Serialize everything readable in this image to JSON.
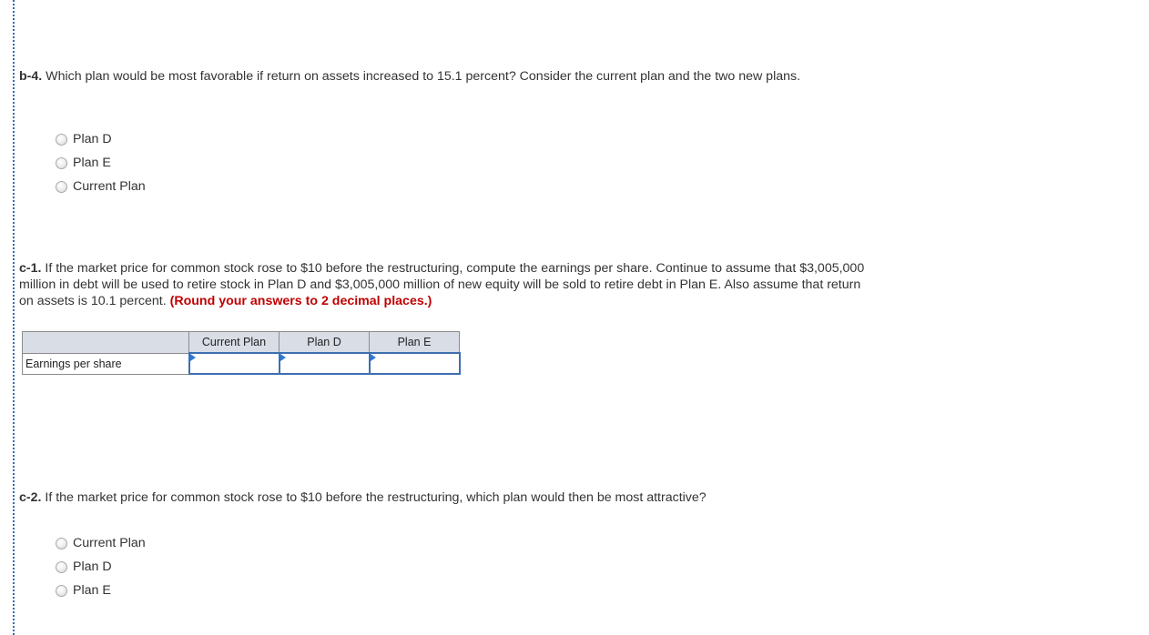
{
  "colors": {
    "accent_rule": "#2f6db5",
    "note_red": "#c00000",
    "table_header_bg": "#d9dde6",
    "input_border": "#3d6fb0"
  },
  "b4": {
    "label": "b-4.",
    "text": " Which plan would be most favorable if return on assets increased to 15.1 percent? Consider the current plan and the two new plans.",
    "options": [
      {
        "label": "Plan D",
        "icon": "radio-unchecked"
      },
      {
        "label": "Plan E",
        "icon": "radio-unchecked"
      },
      {
        "label": "Current Plan",
        "icon": "radio-unchecked"
      }
    ]
  },
  "c1": {
    "label": "c-1.",
    "text": " If the market price for common stock rose to $10 before the restructuring, compute the earnings per share. Continue to assume that $3,005,000 million in debt will be used to retire stock in Plan D and $3,005,000 million of new equity will be sold to retire debt in Plan E. Also assume that return on assets is 10.1 percent. ",
    "note": "(Round your answers to 2 decimal places.)",
    "table": {
      "columns": [
        "",
        "Current Plan",
        "Plan D",
        "Plan E"
      ],
      "rows": [
        {
          "label": "Earnings per share",
          "values": [
            "",
            "",
            ""
          ]
        }
      ]
    }
  },
  "c2": {
    "label": "c-2.",
    "text": " If the market price for common stock rose to $10 before the restructuring, which plan would then be most attractive?",
    "options": [
      {
        "label": "Current Plan",
        "icon": "radio-unchecked"
      },
      {
        "label": "Plan D",
        "icon": "radio-unchecked"
      },
      {
        "label": "Plan E",
        "icon": "radio-unchecked"
      }
    ]
  }
}
